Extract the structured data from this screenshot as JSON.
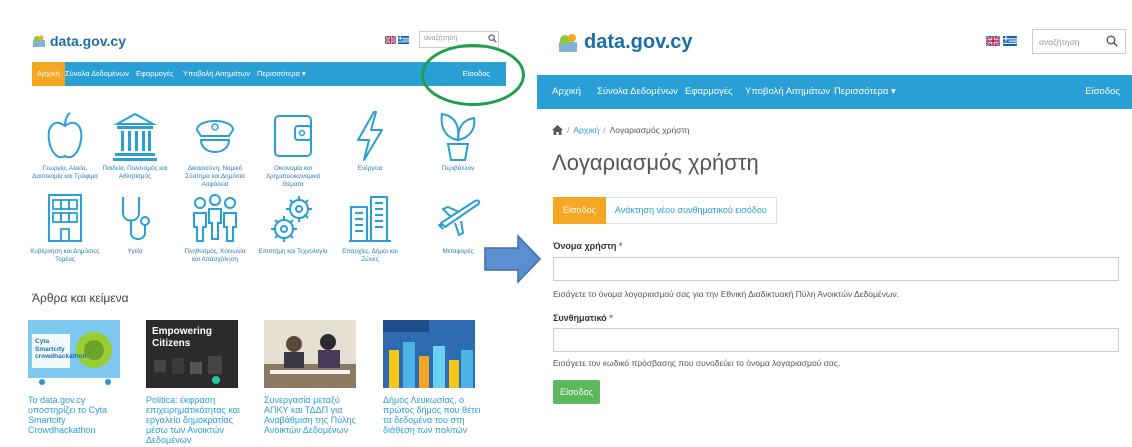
{
  "site": {
    "name": "data.gov.cy"
  },
  "left_page": {
    "search_placeholder": "αναζήτηση",
    "nav": {
      "items": [
        "Αρχική",
        "Σύνολα Δεδομένων",
        "Εφαρμογές",
        "Υποβολή Αιτημάτων",
        "Περισσότερα ▾"
      ],
      "login": "Είσοδος"
    },
    "categories": [
      "Γεωργία, Αλιεία, Δασοκομία και Τρόφιμα",
      "Παιδεία, Πολιτισμός και Αθλητισμός",
      "Δικαιοσύνη, Νομικό Σύστημα και Δημόσια Ασφάλεια",
      "Οικονομία και Χρηματοοικονομικά Θέματα",
      "Ενέργεια",
      "Περιβάλλον",
      "Κυβέρνηση και Δημόσιος Τομέας",
      "Υγεία",
      "Πληθυσμός, Κοινωνία και Απασχόληση",
      "Επιστήμη και Τεχνολογία",
      "Επαρχίες, Δήμοι και Ζώνες",
      "Μεταφορές"
    ],
    "section_title": "Άρθρα και κείμενα",
    "thumb_text": {
      "cyta_brand": "Cyta",
      "cyta_line1": "Smartcity",
      "cyta_line2": "crowdhackathon",
      "empowering": "Empowering",
      "citizens": "Citizens"
    },
    "articles": [
      "Το data.gov.cy υποστηρίζει το Cyta Smartcity Crowdhackathon",
      "Politica: έκφραση επιχειρηματικότητας και εργαλείο δημοκρατίας μέσω των Ανοικτών Δεδομένων",
      "Συνεργασία μεταξύ ΑΠΚΥ και ΤΔΔΠ για Αναβάθμιση της Πύλης Ανοικτών Δεδομένων",
      "Δήμος Λευκωσίας, ο πρώτος δήμος που θέτει τα δεδομένα του στη διάθεση των πολιτών"
    ]
  },
  "right_page": {
    "search_placeholder": "αναζήτηση",
    "nav": {
      "items": [
        "Αρχική",
        "Σύνολα Δεδομένων",
        "Εφαρμογές",
        "Υποβολή Αιτημάτων",
        "Περισσότερα ▾"
      ],
      "login": "Είσοδος"
    },
    "breadcrumb": {
      "separator": "/",
      "home": "Αρχική",
      "current": "Λογαριασμός χρήστη"
    },
    "title": "Λογαριασμός χρήστη",
    "tabs": [
      "Είσοδος",
      "Ανάκτηση νέου συνθηματικού εισόδου"
    ],
    "form": {
      "username_label": "Όνομα χρήστη",
      "required_mark": "*",
      "username_value": "",
      "username_help": "Εισάγετε το όνομα λογαριασμού σας για την Εθνική Διαδικτυακή Πύλη Ανοικτών Δεδομένων.",
      "password_label": "Συνθηματικό",
      "password_value": "",
      "password_help": "Εισάγετε τον κωδικό πρόσβασης που συνοδεύει το όνομα λογαριασμού σας.",
      "submit": "Είσοδος"
    }
  },
  "colors": {
    "nav_blue": "#2a9fd6",
    "active_orange": "#f5a623",
    "link_blue": "#2a9fd6",
    "submit_green": "#5cb85c",
    "annotation_green": "#1ea04a",
    "arrow_blue": "#5b8fcf"
  }
}
